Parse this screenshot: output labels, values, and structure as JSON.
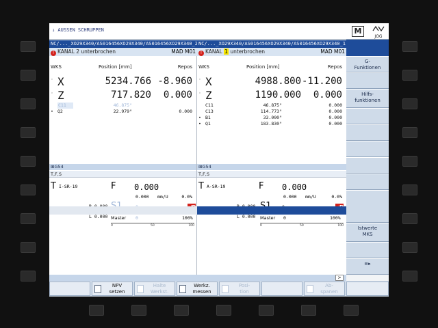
{
  "header": {
    "mode_text": "↓ AUSSEN SCHRUPPEN",
    "machine_icon_letter": "M",
    "jog_icon_label": "JOG"
  },
  "channel2": {
    "path": "NC/..._XO29X340/AS016456XO29X340/AS016456XO29X340_2",
    "status_label": "KANAL 2 unterbrochen",
    "mad": "MAD M01",
    "col_wks": "WKS",
    "col_position": "Position [mm]",
    "col_repos": "Repos",
    "axes_big": [
      {
        "mark": "◦",
        "name": "X",
        "value": "5234.766",
        "repos": "-8.960"
      },
      {
        "mark": "◦",
        "name": "Z",
        "value": "717.820",
        "repos": "0.000"
      }
    ],
    "axes_small": [
      {
        "mark": "",
        "name": "C11",
        "value": "46.875°",
        "repos": ""
      },
      {
        "mark": "•",
        "name": "Q2",
        "value": "22.979°",
        "repos": "0.000"
      }
    ],
    "frame": "G54",
    "tfs_label": "T,F,S",
    "tool_letter": "T",
    "tool_name": "I-SR-19",
    "feed_letter": "F",
    "feed_value": "0.000",
    "feed_sub_value": "0.000",
    "feed_unit": "mm/U",
    "feed_pct": "0.0%",
    "r_label": "R 0.000",
    "l_label": "L 0.000",
    "spindle": "S1",
    "spindle_value": "0",
    "master_label": "Master",
    "master_value": "0",
    "override_pct": "100%",
    "scale": [
      "0",
      "50",
      "100"
    ]
  },
  "channel1": {
    "path": "NC/..._XO29X340/AS016456XO29X340/AS016456XO29X340_1",
    "status_prefix": "KANAL",
    "status_num": "1",
    "status_suffix": "unterbrochen",
    "mad": "MAD M01",
    "col_wks": "WKS",
    "col_position": "Position [mm]",
    "col_repos": "Repos",
    "axes_big": [
      {
        "mark": "◦",
        "name": "X",
        "value": "4988.800",
        "repos": "-11.200"
      },
      {
        "mark": "◦",
        "name": "Z",
        "value": "1190.000",
        "repos": "0.000"
      }
    ],
    "axes_small": [
      {
        "mark": "",
        "name": "C11",
        "value": "46.875°",
        "repos": "0.000"
      },
      {
        "mark": "",
        "name": "C13",
        "value": "114.773°",
        "repos": "0.000"
      },
      {
        "mark": "•",
        "name": "B1",
        "value": "33.000°",
        "repos": "0.000"
      },
      {
        "mark": "•",
        "name": "Q1",
        "value": "183.830°",
        "repos": "0.000"
      }
    ],
    "frame": "G54",
    "tfs_label": "T,F,S",
    "tool_letter": "T",
    "tool_name": "A-SR-19",
    "feed_letter": "F",
    "feed_value": "0.000",
    "feed_sub_value": "0.000",
    "feed_unit": "mm/U",
    "feed_pct": "0.0%",
    "r_label": "R 0.000",
    "l_label": "L 0.000",
    "spindle": "S1",
    "spindle_dir": "▾",
    "spindle_value": "0",
    "master_label": "Master",
    "master_value": "0",
    "override_pct": "100%",
    "scale": [
      "0",
      "50",
      "100"
    ]
  },
  "vertical_softkeys": [
    {
      "line1": "G-",
      "line2": "Funktionen"
    },
    {
      "line1": "",
      "line2": ""
    },
    {
      "line1": "Hilfs-",
      "line2": "funktionen"
    },
    {
      "line1": "",
      "line2": ""
    },
    {
      "line1": "",
      "line2": ""
    },
    {
      "line1": "",
      "line2": ""
    },
    {
      "line1": "",
      "line2": ""
    },
    {
      "line1": "",
      "line2": ""
    },
    {
      "line1": "",
      "line2": ""
    },
    {
      "line1": "Istwerte",
      "line2": "MKS"
    },
    {
      "line1": "",
      "line2": ""
    },
    {
      "line1": "",
      "line2": "≡▸"
    }
  ],
  "status_arrow": ">",
  "horizontal_softkeys": [
    {
      "line1": "",
      "line2": "",
      "dim": false
    },
    {
      "line1": "NPV",
      "line2": "setzen",
      "dim": false
    },
    {
      "line1": "Halte",
      "line2": "Werkst.",
      "dim": true
    },
    {
      "line1": "Werkz.",
      "line2": "messen",
      "dim": false
    },
    {
      "line1": "Posi-",
      "line2": "tion",
      "dim": true
    },
    {
      "line1": "",
      "line2": "",
      "dim": false
    },
    {
      "line1": "Ab-",
      "line2": "spanen",
      "dim": true
    }
  ]
}
